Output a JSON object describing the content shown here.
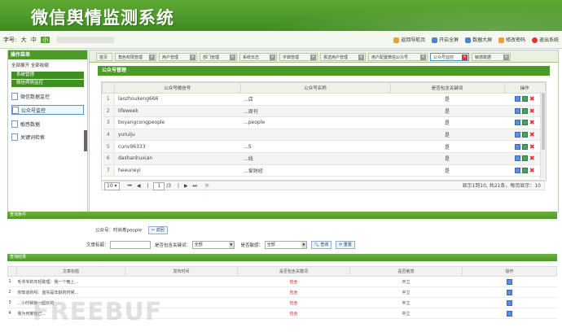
{
  "app_title": "微信舆情监测系统",
  "font_size": {
    "label": "字号:",
    "options": [
      "大",
      "中",
      "小"
    ],
    "selected": "小"
  },
  "top_links": [
    "返回导航页",
    "开启全屏",
    "数据大屏",
    "修改密码",
    "退出系统"
  ],
  "sidebar": {
    "header": "操作菜单",
    "expand_collapse": "全部展开  全部收缩",
    "groups": [
      "系统管理",
      "微信舆情监控"
    ],
    "items": [
      "微信数据监控",
      "公众号监控",
      "敏感数据",
      "关键词检索"
    ]
  },
  "tabs": [
    "首页",
    "角色权限管理",
    "用户管理",
    "部门管理",
    "系统日志",
    "字典管理",
    "报送用户管理",
    "用户配置微信公众号",
    "公众号监控",
    "敏感数据"
  ],
  "active_tab": "公众号监控",
  "panel_title": "公众号管理",
  "grid": {
    "columns": [
      "公众号微信号",
      "公众号名称",
      "是否包含关键词",
      "操作"
    ],
    "rows": [
      {
        "n": "1",
        "account": "laozhoukeng666",
        "name": "...店",
        "has_kw": "是"
      },
      {
        "n": "2",
        "account": "lifeweek",
        "name": "...周刊",
        "has_kw": "是"
      },
      {
        "n": "3",
        "account": "boyangcongpeople",
        "name": "...people",
        "has_kw": "是"
      },
      {
        "n": "4",
        "account": "yuruiju",
        "name": "",
        "has_kw": "是"
      },
      {
        "n": "5",
        "account": "cunv96333",
        "name": "...S",
        "has_kw": "是"
      },
      {
        "n": "6",
        "account": "dashanhuxian",
        "name": "...线",
        "has_kw": "是"
      },
      {
        "n": "7",
        "account": "heeuneyi",
        "name": "...爱财经",
        "has_kw": "是"
      }
    ]
  },
  "pager": {
    "page_size": "10",
    "page": "1",
    "total_pages": "/3",
    "info": "显示1到10, 共21条，每页显示：10"
  },
  "query_section": "查询条件",
  "query": {
    "account_label": "公众号：",
    "account_value": "时尚卷people",
    "back_button": "返回",
    "title_label": "文章标题：",
    "kw_label": "是否包含关键词：",
    "kw_value": "全部",
    "sensitive_label": "是否敏感：",
    "sensitive_value": "全部",
    "query_button": "查询",
    "reset_button": "重置"
  },
  "result_section": "查询结果",
  "results": {
    "columns": [
      "文章标题",
      "发布时间",
      "是否包含关键词",
      "是否敏感",
      "操作"
    ],
    "rows": [
      {
        "n": "1",
        "title": "毛爷爷的年轻助理：我一个晚上...",
        "kw": "包含",
        "sens": "中立"
      },
      {
        "n": "2",
        "title": "你知道的吗：首先是年龄的时候...",
        "kw": "包含",
        "sens": "中立"
      },
      {
        "n": "3",
        "title": "...小时候就一起长的",
        "kw": "包含",
        "sens": "中立"
      },
      {
        "n": "4",
        "title": "我为何被自己...",
        "kw": "包含",
        "sens": "中立"
      }
    ]
  },
  "watermark": "FREEBUF",
  "colors": {
    "green": "#4c9a2a",
    "red": "#e03030",
    "blue": "#5c8fd6"
  }
}
